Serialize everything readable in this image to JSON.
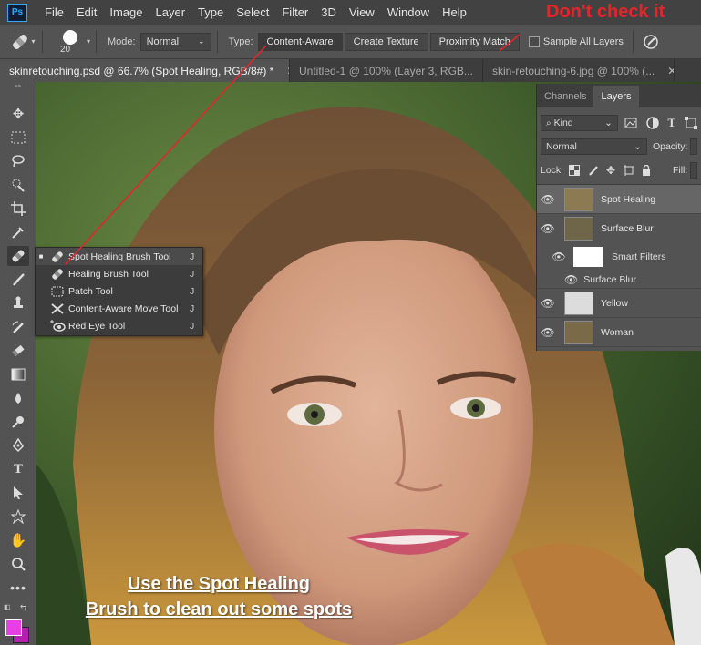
{
  "app": {
    "logo": "Ps"
  },
  "menu": [
    "File",
    "Edit",
    "Image",
    "Layer",
    "Type",
    "Select",
    "Filter",
    "3D",
    "View",
    "Window",
    "Help"
  ],
  "annotation_top": "Don't check it",
  "options": {
    "brush_size": "20",
    "mode_label": "Mode:",
    "mode_value": "Normal",
    "type_label": "Type:",
    "type_buttons": [
      "Content-Aware",
      "Create Texture",
      "Proximity Match"
    ],
    "sample_all_layers": "Sample All Layers",
    "sample_all_layers_checked": false
  },
  "tabs": [
    {
      "label": "skinretouching.psd @ 66.7% (Spot Healing, RGB/8#) *",
      "active": true
    },
    {
      "label": "Untitled-1 @ 100% (Layer 3, RGB...",
      "active": false
    },
    {
      "label": "skin-retouching-6.jpg @ 100% (...",
      "active": false
    }
  ],
  "flyout": [
    {
      "name": "Spot Healing Brush Tool",
      "shortcut": "J",
      "selected": true,
      "icon": "spot-healing-icon"
    },
    {
      "name": "Healing Brush Tool",
      "shortcut": "J",
      "selected": false,
      "icon": "healing-brush-icon"
    },
    {
      "name": "Patch Tool",
      "shortcut": "J",
      "selected": false,
      "icon": "patch-icon"
    },
    {
      "name": "Content-Aware Move Tool",
      "shortcut": "J",
      "selected": false,
      "icon": "content-aware-move-icon"
    },
    {
      "name": "Red Eye Tool",
      "shortcut": "J",
      "selected": false,
      "icon": "red-eye-icon"
    }
  ],
  "panel": {
    "tabs": [
      "Channels",
      "Layers"
    ],
    "kind_label": "Kind",
    "blend_mode": "Normal",
    "opacity_label": "Opacity:",
    "lock_label": "Lock:",
    "fill_label": "Fill:",
    "layers": [
      {
        "name": "Spot Healing",
        "selected": true
      },
      {
        "name": "Surface Blur",
        "selected": false
      },
      {
        "name": "Yellow",
        "selected": false
      },
      {
        "name": "Woman",
        "selected": false
      }
    ],
    "smart_filters": "Smart Filters",
    "smart_filter_item": "Surface Blur"
  },
  "caption": {
    "line1": "Use the Spot Healing",
    "line2": "Brush to clean out some spots"
  },
  "colors": {
    "foreground": "#e83ee8",
    "background": "#b41fb4",
    "annotation": "#e3262a"
  }
}
